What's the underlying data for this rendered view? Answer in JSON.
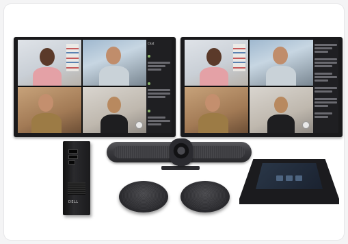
{
  "scene": {
    "description_tags": [
      "monitor-left",
      "monitor-right",
      "mini-pc",
      "video-bar",
      "speaker",
      "touch-controller"
    ]
  },
  "monitors": [
    {
      "chat_title": "Chat"
    },
    {
      "chat_title": ""
    }
  ],
  "mini_pc": {
    "brand": "DELL"
  },
  "colors": {
    "background": "#ffffff",
    "device_dark": "#1b1b1e",
    "chat_panel": "#1f1f22"
  }
}
